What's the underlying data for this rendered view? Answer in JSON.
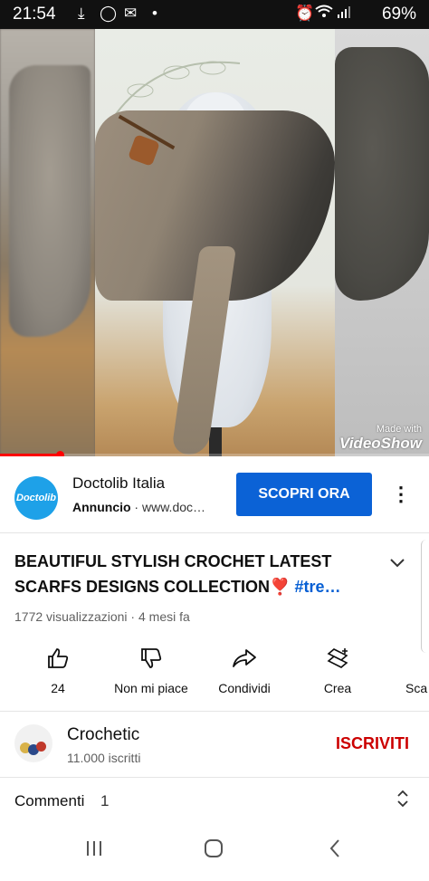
{
  "status_bar": {
    "time": "21:54",
    "battery": "69%",
    "icons": [
      "download-icon",
      "whatsapp-icon",
      "mail-icon",
      "dot-icon",
      "alarm-icon",
      "wifi-icon",
      "signal-icon"
    ]
  },
  "video": {
    "watermark_small": "Made with",
    "watermark_brand": "VideoShow",
    "progress": 0.14
  },
  "ad": {
    "logo_text": "Doctolib",
    "advertiser": "Doctolib Italia",
    "label": "Annuncio",
    "domain": "www.doc…",
    "cta": "SCOPRI ORA"
  },
  "video_info": {
    "title": "BEAUTIFUL STYLISH CROCHET LATEST SCARFS DESIGNS COLLECTION❣️",
    "hashtag": "#tre…",
    "views": "1772 visualizzazioni",
    "age": "4 mesi fa"
  },
  "actions": {
    "like_count": "24",
    "dislike": "Non mi piace",
    "share": "Condividi",
    "create": "Crea",
    "save_partial": "Sca"
  },
  "channel": {
    "name": "Crochetic",
    "subscribers": "11.000 iscritti",
    "subscribe": "ISCRIVITI"
  },
  "comments": {
    "label": "Commenti",
    "count": "1"
  },
  "colors": {
    "accent_blue": "#0b62d6",
    "subscribe_red": "#cc0000",
    "progress_red": "#ff0000",
    "link_blue": "#065fd4"
  }
}
